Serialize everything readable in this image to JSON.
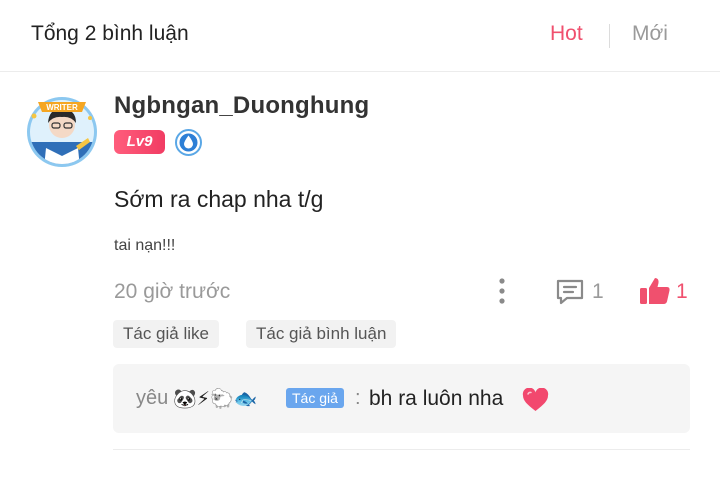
{
  "header": {
    "total_label": "Tổng 2 bình luận",
    "sort_hot": "Hot",
    "sort_new": "Mới"
  },
  "comment": {
    "username": "Ngbngan_Duonghung",
    "level": "Lv9",
    "avatar_badge_text": "WRITER",
    "content": "Sớm ra chap nha t/g",
    "subtext": "tai nạn!!!",
    "time": "20 giờ trước",
    "reply_count": "1",
    "like_count": "1",
    "tags": [
      "Tác giả like",
      "Tác giả bình luận"
    ]
  },
  "reply": {
    "name": "yêu",
    "emojis": [
      "🐼",
      "⚡",
      "🐑",
      "🐟"
    ],
    "author_badge": "Tác giả",
    "colon": ":",
    "text": "bh ra luôn nha"
  },
  "colors": {
    "accent": "#f0506e",
    "muted": "#9a9a9a",
    "author_badge": "#6aa6ee"
  },
  "icons": {
    "more": "more-vertical-icon",
    "reply": "comment-icon",
    "like": "thumbs-up-icon",
    "heart": "heart-icon",
    "level_badge": "water-drop-icon"
  }
}
